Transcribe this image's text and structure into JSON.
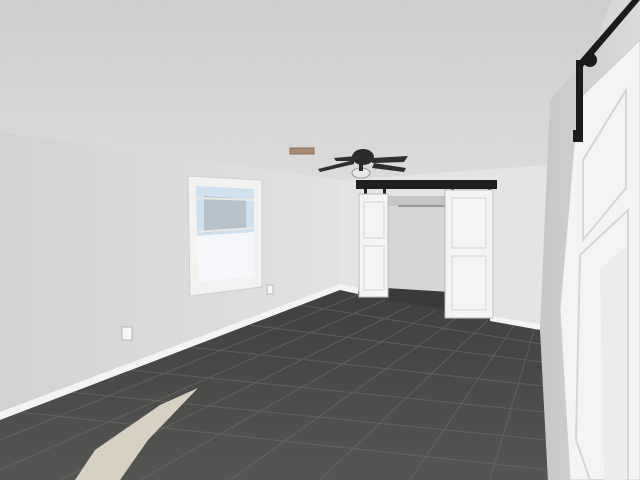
{
  "scene": {
    "kind": "photo",
    "description_colors": {
      "ceiling": "#d9d9d7",
      "wall_left": "#dcdcda",
      "wall_back": "#e6e6e4",
      "wall_right": "#cfcfcd",
      "floor": "#4a4a4a",
      "grout": "#6a6a68",
      "trim": "#f2f2f0",
      "door": "#f4f4f2",
      "hardware": "#1e1e1e",
      "fan": "#2b2b2b",
      "window_sky": "#cfe0ef",
      "snow": "#f5f7fa",
      "sunlight": "#efe8d8"
    }
  }
}
